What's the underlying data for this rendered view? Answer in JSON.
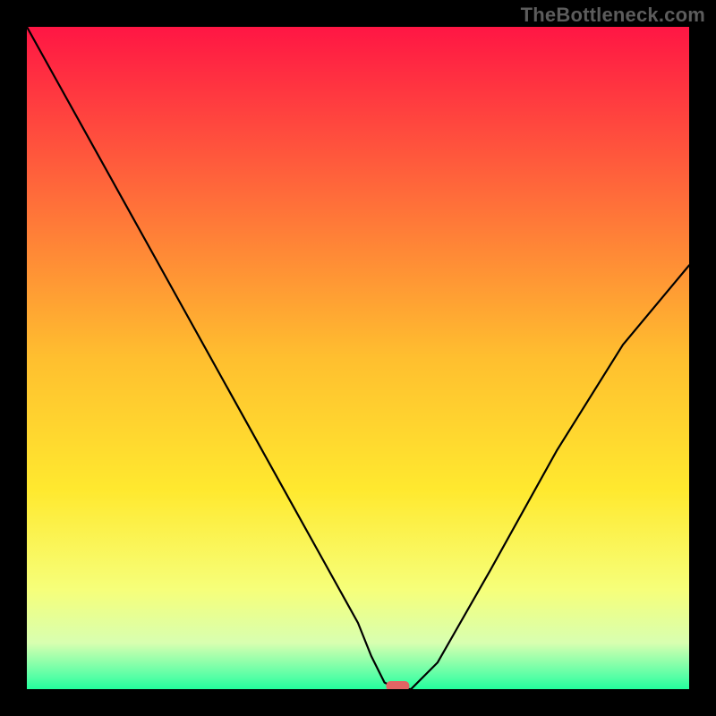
{
  "watermark": "TheBottleneck.com",
  "chart_data": {
    "type": "line",
    "title": "",
    "xlabel": "",
    "ylabel": "",
    "xlim": [
      0,
      100
    ],
    "ylim": [
      0,
      100
    ],
    "grid": false,
    "legend": false,
    "background_gradient": {
      "stops": [
        {
          "offset": 0.0,
          "color": "#ff1644"
        },
        {
          "offset": 0.25,
          "color": "#ff6a3a"
        },
        {
          "offset": 0.5,
          "color": "#ffbf2f"
        },
        {
          "offset": 0.7,
          "color": "#ffe92f"
        },
        {
          "offset": 0.85,
          "color": "#f6ff7a"
        },
        {
          "offset": 0.93,
          "color": "#d8ffb0"
        },
        {
          "offset": 0.98,
          "color": "#5affa6"
        },
        {
          "offset": 1.0,
          "color": "#23ff9d"
        }
      ]
    },
    "series": [
      {
        "name": "bottleneck-curve",
        "x": [
          0,
          5,
          10,
          15,
          20,
          25,
          30,
          35,
          40,
          45,
          50,
          52,
          54,
          56,
          58,
          62,
          70,
          80,
          90,
          100
        ],
        "values": [
          100,
          91,
          82,
          73,
          64,
          55,
          46,
          37,
          28,
          19,
          10,
          5,
          1,
          0,
          0,
          4,
          18,
          36,
          52,
          64
        ]
      }
    ],
    "marker": {
      "x": 56,
      "y": 0,
      "color": "#e36464"
    }
  }
}
